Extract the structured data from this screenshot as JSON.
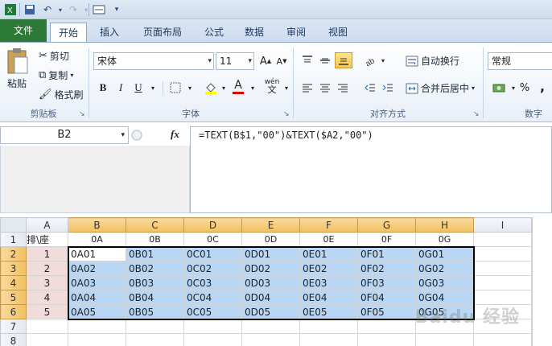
{
  "tabs": [
    "文件",
    "开始",
    "插入",
    "页面布局",
    "公式",
    "数据",
    "审阅",
    "视图"
  ],
  "clipboard": {
    "paste": "粘贴",
    "cut": "剪切",
    "copy": "复制",
    "format_painter": "格式刷",
    "label": "剪贴板"
  },
  "font": {
    "name": "宋体",
    "size": "11",
    "bold": "B",
    "italic": "I",
    "underline": "U",
    "label": "字体"
  },
  "alignment": {
    "wrap": "自动换行",
    "merge": "合并后居中",
    "label": "对齐方式"
  },
  "number": {
    "format": "常规",
    "percent": "%",
    "comma": ",",
    "label": "数字"
  },
  "namebox": "B2",
  "fx": "fx",
  "formula": "=TEXT(B$1,\"00\")&TEXT($A2,\"00\")",
  "columns": [
    "A",
    "B",
    "C",
    "D",
    "E",
    "F",
    "G",
    "H",
    "I"
  ],
  "rows": [
    {
      "num": "1",
      "a": "排\\座",
      "cells": [
        "0A",
        "0B",
        "0C",
        "0D",
        "0E",
        "0F",
        "0G"
      ]
    },
    {
      "num": "2",
      "a": "1",
      "cells": [
        "0A01",
        "0B01",
        "0C01",
        "0D01",
        "0E01",
        "0F01",
        "0G01"
      ]
    },
    {
      "num": "3",
      "a": "2",
      "cells": [
        "0A02",
        "0B02",
        "0C02",
        "0D02",
        "0E02",
        "0F02",
        "0G02"
      ]
    },
    {
      "num": "4",
      "a": "3",
      "cells": [
        "0A03",
        "0B03",
        "0C03",
        "0D03",
        "0E03",
        "0F03",
        "0G03"
      ]
    },
    {
      "num": "5",
      "a": "4",
      "cells": [
        "0A04",
        "0B04",
        "0C04",
        "0D04",
        "0E04",
        "0F04",
        "0G04"
      ]
    },
    {
      "num": "6",
      "a": "5",
      "cells": [
        "0A05",
        "0B05",
        "0C05",
        "0D05",
        "0E05",
        "0F05",
        "0G05"
      ]
    },
    {
      "num": "7",
      "a": "",
      "cells": [
        "",
        "",
        "",
        "",
        "",
        "",
        ""
      ]
    },
    {
      "num": "8",
      "a": "",
      "cells": [
        "",
        "",
        "",
        "",
        "",
        "",
        ""
      ]
    }
  ],
  "watermark": "Baidu 经验",
  "colors": {
    "file_tab": "#2d7a38",
    "selection": "#b9d7f4",
    "column_a": "#f2dcdb",
    "header_selected": "#f1c15f"
  }
}
